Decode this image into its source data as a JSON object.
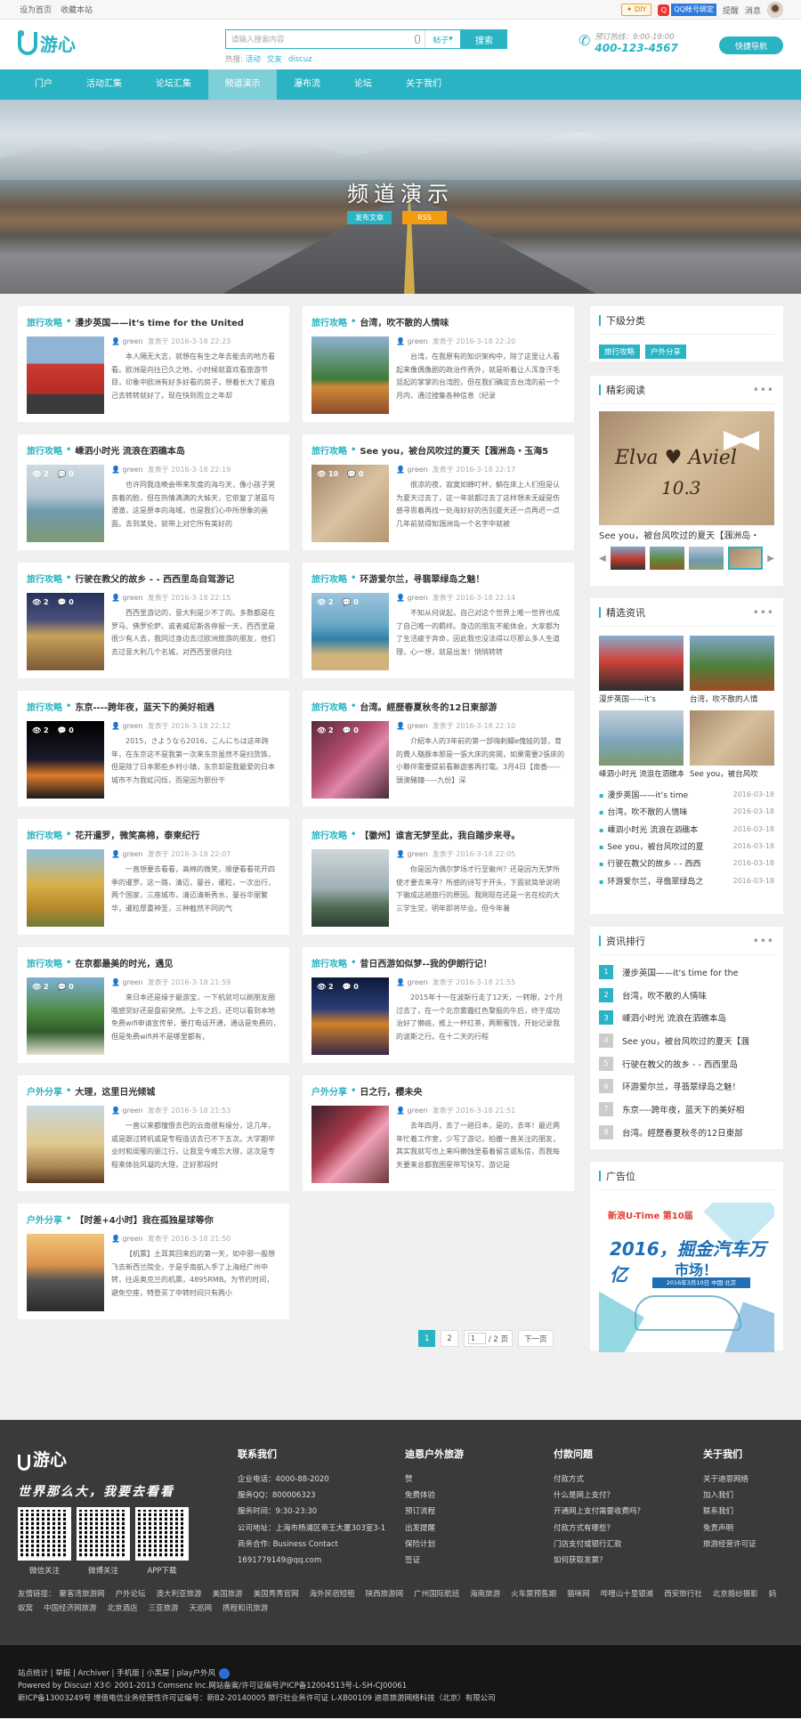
{
  "topbar": {
    "links": [
      "设为首页",
      "收藏本站"
    ],
    "diy": "DIY",
    "qq_bind": "QQ帐号绑定",
    "remind": "提醒",
    "messages": "消息"
  },
  "header": {
    "logo": "游心",
    "search_placeholder": "请输入搜索内容",
    "search_type": "帖子",
    "search_btn": "搜索",
    "hot_label": "热搜:",
    "hot": [
      "活动",
      "交友",
      "discuz"
    ],
    "hotline_label": "预订热线：9:00-19:00",
    "hotline_number": "400-123-4567",
    "quicknav": "快捷导航"
  },
  "nav": [
    "门户",
    "活动汇集",
    "论坛汇集",
    "频道演示",
    "瀑布流",
    "论坛",
    "关于我们"
  ],
  "banner": {
    "title": "频道演示",
    "btn_post": "发布文章",
    "btn_rss": "RSS"
  },
  "articles": [
    {
      "cat": "旅行攻略",
      "title": "漫步英国——it‘s time for the United",
      "user": "green",
      "date": "发表于 2016-3-18 22:23",
      "views": "",
      "replies": "",
      "summary": "本人隔无大志，就想在有生之年去能去的地方看看。欧洲是向往已久之地，小时候就喜欢看旅游节目，印象中欧洲有好多好看的房子，想着长大了能自己去转转就好了。现在快到而立之年却"
    },
    {
      "cat": "旅行攻略",
      "title": "台湾，吹不散的人情味",
      "user": "green",
      "date": "发表于 2016-3-18 22:20",
      "views": "",
      "replies": "",
      "summary": "台湾，在我原有的知识架构中，除了这里让人看起来像偶像剧的政治作秀外，就是听着让人浑身汗毛竖起的掌掌的台湾腔。但在我们确定去台湾的前一个月内，通过搜集各种信息（纪录"
    },
    {
      "cat": "旅行攻略",
      "title": "嵊泗小时光 流浪在泗礁本岛",
      "user": "green",
      "date": "发表于 2016-3-18 22:19",
      "views": "2",
      "replies": "0",
      "summary": "也许同我连晚会带来灰度的海与天，像小孩子哭丧着的脸，但在热情满满的大姊天，它依复了湛蓝与澄澈，这是原本的海域，也是我们心中所想象的画面。去到某处，就带上对它所有美好的"
    },
    {
      "cat": "旅行攻略",
      "title": "See you，被台风吹过的夏天【涠洲岛・玉海5",
      "user": "green",
      "date": "发表于 2016-3-18 22:17",
      "views": "10",
      "replies": "0",
      "summary": "很凉的夜，寂寞如蝉叮杯，躺在床上人们但是认为夏天过去了，这一年就都过去了这样想未无疑是伤感寻思着再找一处海好好的告别夏天还一点再迟一点几年前就得知涠洲岛一个名字中就被"
    },
    {
      "cat": "旅行攻略",
      "title": "行驶在教父的故乡 - - 西西里岛自驾游记",
      "user": "green",
      "date": "发表于 2016-3-18 22:15",
      "views": "2",
      "replies": "0",
      "summary": "西西里游记的，意大利是少不了的。多数都是在罗马、佛罗伦萨、或者威尼斯各停留一天，西西里是很少有人去，我同过身边去过欧洲旅游的朋友，他们去过意大利几个名城，对西西里很向往"
    },
    {
      "cat": "旅行攻略",
      "title": "环游爱尔兰，寻翡翠绿岛之魅！",
      "user": "green",
      "date": "发表于 2016-3-18 22:14",
      "views": "2",
      "replies": "0",
      "summary": "不知从何说起，自己对这个世界上唯一世界也成了自己唯一的羁绊。身边的朋友不能体会，大家都为了生活疲于奔命，因此我也没法得以尽那么多人生道理，心一想，就是出发！悄悄转转"
    },
    {
      "cat": "旅行攻略",
      "title": "东京----跨年夜，蓝天下的美好相遇",
      "user": "green",
      "date": "发表于 2016-3-18 22:12",
      "views": "2",
      "replies": "0",
      "summary": "2015，さようなら2016，こんにちは这年跨年，在东京这不是我第一次来东京虽然不是扫货族，但是除了日本那些乡村小镇，东京却是我最爱的日本城市不为我虹闪烁，而是因为那份干"
    },
    {
      "cat": "旅行攻略",
      "title": "台湾。經歷春夏秋冬的12日東部游",
      "user": "green",
      "date": "发表于 2016-3-18 22:10",
      "views": "2",
      "replies": "0",
      "summary": "介紹本人的3年前的第一部嗨剌鳔e傀娃的慧，育的費人駱豚本那是一張大床的房間，如果需要2張床的小夥伴需要提前看聯遊客再打電。3月4日【南香-----頭澳豬鐘-----九份】深"
    },
    {
      "cat": "旅行攻略",
      "title": "花开暹罗，微笑高棉，泰柬纪行",
      "user": "green",
      "date": "发表于 2016-3-18 22:07",
      "views": "",
      "replies": "",
      "summary": "一直想要去看看，高棉的微笑，顺便看看花开四季的暹罗。这一路，清迈，曼谷，暹粒，一次出行，两个国家，三座城市，清迈清新秀水，曼谷华丽繁华，暹粒厚重神圣，三种截然不同的气"
    },
    {
      "cat": "旅行攻略",
      "title": "【徽州】谁言无梦至此，我自踏步来寻。",
      "user": "green",
      "date": "发表于 2016-3-18 22:05",
      "views": "",
      "replies": "",
      "summary": "你是因为偶尔梦场才行至徽州？还是因为无梦所使才要去来寻？所感的诗写于开头，下面就简单说明下徽成这趟旅行的原因。我刚现在还是一名在校的大三学生党，明年即将毕业。但今年暑"
    },
    {
      "cat": "旅行攻略",
      "title": "在京都最美的时光，遇见",
      "user": "green",
      "date": "发表于 2016-3-18 21:59",
      "views": "2",
      "replies": "0",
      "summary": "来日本还是缘于最游宝，一下机就可以刷朋友圈哦感觉好还是盘前突然。上午之后，还可以看到本地免费wifi申请宣传单，要打电话开通，通话是免费的，但是免费wifi并不是哪里都有，"
    },
    {
      "cat": "旅行攻略",
      "title": "昔日西游如似梦--我的伊朗行记！",
      "user": "green",
      "date": "发表于 2016-3-18 21:55",
      "views": "2",
      "replies": "0",
      "summary": "2015年十一在波斯行走了12天，一转眼，2个月过去了，在一个北京雾霾红色警报的午后，终于成功治好了懒癌，推上一杯红茶，两颗蜜饯，开始记录我的波斯之行。在十二天的行程"
    },
    {
      "cat": "户外分享",
      "title": "大理，这里日光倾城",
      "user": "green",
      "date": "发表于 2016-3-18 21:53",
      "views": "",
      "replies": "",
      "summary": "一直以来都憧憬去巴的云南很有缘分，这几年，或是跟过转机或是专程造访去已不下五次。大学期毕业时和闺蜜的丽江行，让我至今难忘大理，这次是专程来体验风凝的大理，正好那段时"
    },
    {
      "cat": "户外分享",
      "title": "日之行，樱未央",
      "user": "green",
      "date": "发表于 2016-3-18 21:51",
      "views": "",
      "replies": "",
      "summary": "去年四月，去了一趟日本，是的，去年！最近两年忙着工作室，少写了游记，拍撤一直关注的朋友，其实我就写也上来吗懒蚀里看着留言或私信，而我每天要来总都我困星带写快写，游记是"
    },
    {
      "cat": "户外分享",
      "title": "【时差+4小时】我在孤独星球等你",
      "user": "green",
      "date": "发表于 2016-3-18 21:50",
      "views": "",
      "replies": "",
      "summary": "【机票】土耳其回来后的第一天，如中邪一般想飞去新西兰院全，于是乎南航入手了上海经广州中转，往返奥克兰的机票，4895RMB。为节约时间，避免空座，特登买了中转时间只有两小"
    }
  ],
  "pager": {
    "pages": [
      "1",
      "2"
    ],
    "current": "1",
    "input": "1",
    "total": "/ 2 页",
    "next": "下一页"
  },
  "sidebar": {
    "subcat_title": "下级分类",
    "subcats": [
      "旅行攻略",
      "户外分享"
    ],
    "featured_title": "精彩阅读",
    "featured_caption": "See you，被台风吹过的夏天【涠洲岛・",
    "picks_title": "精选资讯",
    "picks": [
      "漫步英国——it‘s",
      "台湾，吹不散的人情",
      "嵊泗小时光 流浪在泗礁本",
      "See you，被台风吹"
    ],
    "news": [
      {
        "t": "漫步英国——it‘s time",
        "d": "2016-03-18"
      },
      {
        "t": "台湾，吹不散的人情味",
        "d": "2016-03-18"
      },
      {
        "t": "嵊泗小时光 流浪在泗礁本",
        "d": "2016-03-18"
      },
      {
        "t": "See you，被台风吹过的夏",
        "d": "2016-03-18"
      },
      {
        "t": "行驶在教父的故乡 - - 西西",
        "d": "2016-03-18"
      },
      {
        "t": "环游爱尔兰，寻翡翠绿岛之",
        "d": "2016-03-18"
      }
    ],
    "rank_title": "资讯排行",
    "rank": [
      "漫步英国——it‘s time for the",
      "台湾，吹不散的人情味",
      "嵊泗小时光 流浪在泗礁本岛",
      "See you，被台风吹过的夏天【涠",
      "行驶在教父的故乡 - - 西西里岛",
      "环游爱尔兰，寻翡翠绿岛之魅！",
      "东京----跨年夜，蓝天下的美好相",
      "台湾。經歷春夏秋冬的12日東部"
    ],
    "ad_title": "广告位",
    "ad_text1": "新浪U-Time 第10届",
    "ad_text2": "2016，掘金汽车万亿",
    "ad_text3": "市场！",
    "ad_text4": "2016年3月10日 中国·北京"
  },
  "footer": {
    "logo": "游心",
    "slogan": "世界那么大，我要去看看",
    "qr": [
      "微信关注",
      "微博关注",
      "APP下载"
    ],
    "cols": [
      {
        "h": "联系我们",
        "items": [
          "企业电话：4000-88-2020",
          "服务QQ：800006323",
          "服务时间：9:30-23:30",
          "公司地址：上海市杨浦区帝王大厦303室3-1",
          "商务合作: Business Contact",
          "1691779149@qq.com"
        ]
      },
      {
        "h": "迪恩户外旅游",
        "items": [
          "赞",
          "免费体验",
          "预订流程",
          "出发提醒",
          "保险计划",
          "签证"
        ]
      },
      {
        "h": "付款问题",
        "items": [
          "付款方式",
          "什么是网上支付？",
          "开通网上支付需要收费吗？",
          "付款方式有哪些？",
          "门店支付或银行汇款",
          "如何获取发票？"
        ]
      },
      {
        "h": "关于我们",
        "items": [
          "关于迪恩网络",
          "加入我们",
          "联系我们",
          "免责声明",
          "旅游经营许可证"
        ]
      }
    ],
    "friend_label": "友情链接：",
    "friends": [
      "聚客湾旅游网",
      "户外论坛",
      "澳大利亚旅游",
      "美国旅游",
      "美国秀秀官网",
      "海外民宿短租",
      "陕西旅游网",
      "广州国际航班",
      "海南旅游",
      "火车票预售期",
      "猫咪网",
      "哔哩山十里银滩",
      "西安旅行社",
      "北京婚纱摄影",
      "蚂蚁窝",
      "中国经济网旅游",
      "北京酒店",
      "三亚旅游",
      "天巡网",
      "携程和讯旅游"
    ],
    "bottom_links": "站点统计 | 举报 | Archiver | 手机版 | 小黑屋 | play户外风",
    "powered": "Powered by Discuz! X3© 2001-2013 Comsenz Inc.网站备案/许可证编号沪ICP备12004513号-L-SH-CJ00061",
    "icp": "新ICP备13003249号 增值电信业务经营性许可证编号：新B2-20140005 旅行社业务许可证 L-XB00109 迪恩旅游网络科技（北京）有限公司"
  }
}
